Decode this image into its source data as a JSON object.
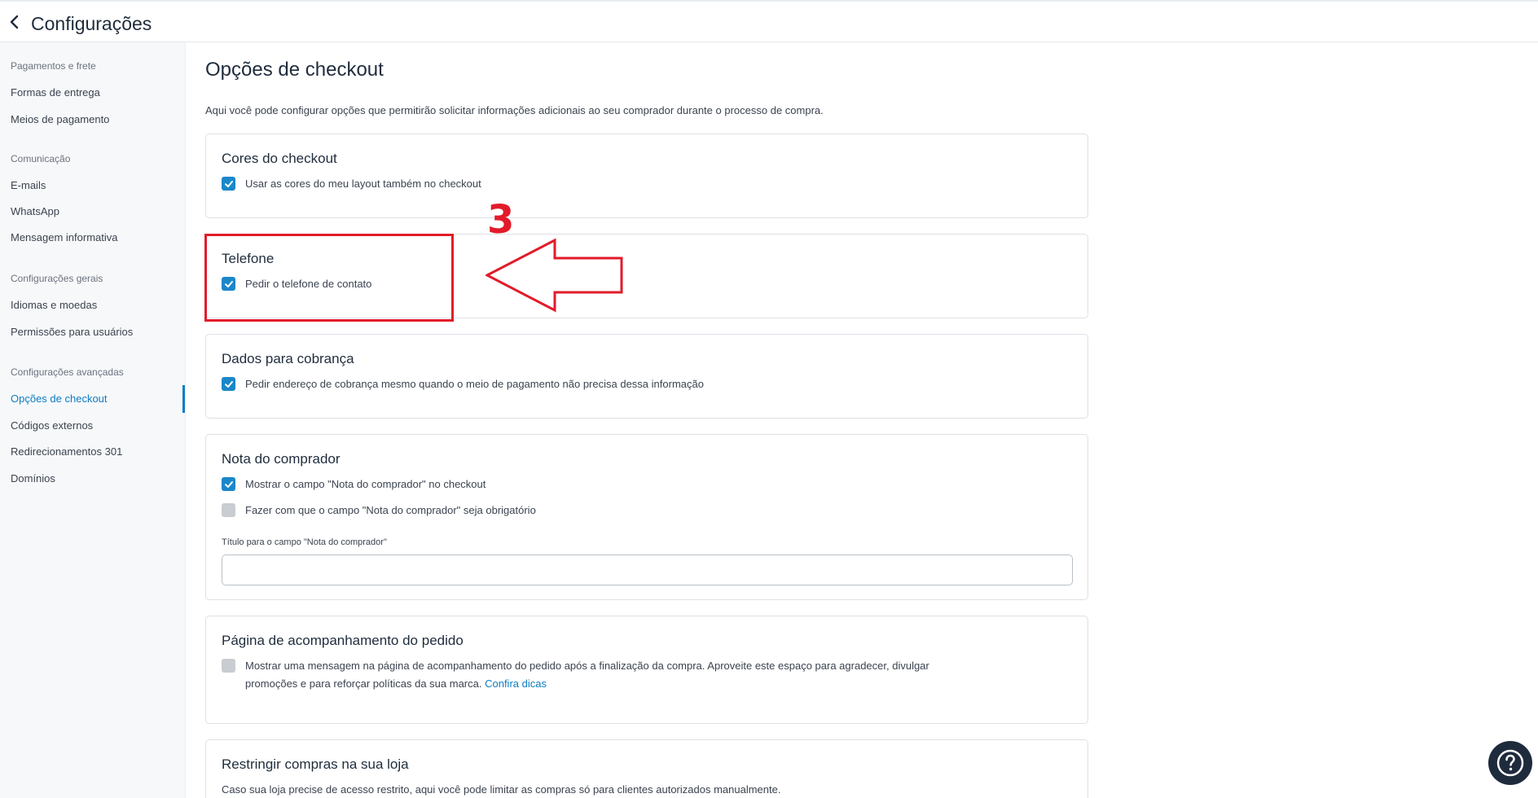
{
  "header": {
    "title": "Configurações"
  },
  "sidebar": {
    "groups": [
      {
        "title": "Pagamentos e frete",
        "items": [
          "Formas de entrega",
          "Meios de pagamento"
        ]
      },
      {
        "title": "Comunicação",
        "items": [
          "E-mails",
          "WhatsApp",
          "Mensagem informativa"
        ]
      },
      {
        "title": "Configurações gerais",
        "items": [
          "Idiomas e moedas",
          "Permissões para usuários"
        ]
      },
      {
        "title": "Configurações avançadas",
        "items": [
          "Opções de checkout",
          "Códigos externos",
          "Redirecionamentos 301",
          "Domínios"
        ]
      }
    ],
    "active_item": "Opções de checkout"
  },
  "main": {
    "title": "Opções de checkout",
    "description": "Aqui você pode configurar opções que permitirão solicitar informações adicionais ao seu comprador durante o processo de compra.",
    "cards": [
      {
        "title": "Cores do checkout",
        "options": [
          {
            "label": "Usar as cores do meu layout também no checkout",
            "checked": true
          }
        ]
      },
      {
        "title": "Telefone",
        "options": [
          {
            "label": "Pedir o telefone de contato",
            "checked": true
          }
        ]
      },
      {
        "title": "Dados para cobrança",
        "options": [
          {
            "label": "Pedir endereço de cobrança mesmo quando o meio de pagamento não precisa dessa informação",
            "checked": true
          }
        ]
      },
      {
        "title": "Nota do comprador",
        "options": [
          {
            "label": "Mostrar o campo \"Nota do comprador\" no checkout",
            "checked": true
          },
          {
            "label": "Fazer com que o campo \"Nota do comprador\" seja obrigatório",
            "checked": false
          }
        ],
        "field_label": "Título para o campo \"Nota do comprador\"",
        "field_value": ""
      },
      {
        "title": "Página de acompanhamento do pedido",
        "options": [
          {
            "label_line1": "Mostrar uma mensagem na página de acompanhamento do pedido após a finalização da compra. Aproveite este espaço para agradecer, divulgar",
            "label_line2": "promoções e para reforçar políticas da sua marca.",
            "link": "Confira dicas",
            "checked": false
          }
        ]
      },
      {
        "title": "Restringir compras na sua loja",
        "description": "Caso sua loja precise de acesso restrito, aqui você pode limitar as compras só para clientes autorizados manualmente."
      }
    ]
  },
  "annotation": {
    "number": "3",
    "color": "#e21b2a"
  },
  "colors": {
    "accent": "#0e7cc2",
    "checkbox_on": "#1b87c9",
    "checkbox_off": "#c9cdd2",
    "help_button": "#1e2b3c"
  },
  "icons": {
    "back": "chevron-left-icon",
    "check": "checkmark-icon",
    "help": "question-mark-icon"
  }
}
